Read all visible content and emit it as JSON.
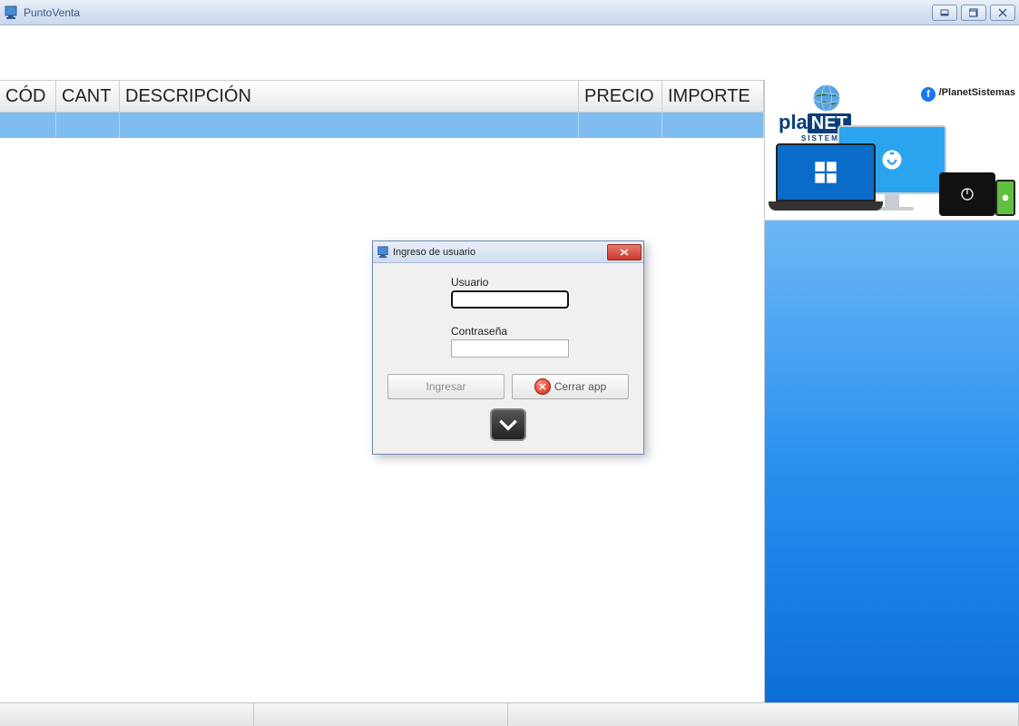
{
  "window": {
    "title": "PuntoVenta"
  },
  "table": {
    "headers": {
      "cod": "CÓD",
      "cant": "CANT",
      "desc": "DESCRIPCIÓN",
      "precio": "PRECIO",
      "importe": "IMPORTE"
    }
  },
  "brand": {
    "prefix": "pla",
    "highlight": "NET",
    "subtitle": "SISTEMAS",
    "social_handle": "/PlanetSistemas"
  },
  "login_dialog": {
    "title": "Ingreso de usuario",
    "user_label": "Usuario",
    "user_value": "",
    "password_label": "Contraseña",
    "password_value": "",
    "login_button": "Ingresar",
    "close_button": "Cerrar app"
  }
}
